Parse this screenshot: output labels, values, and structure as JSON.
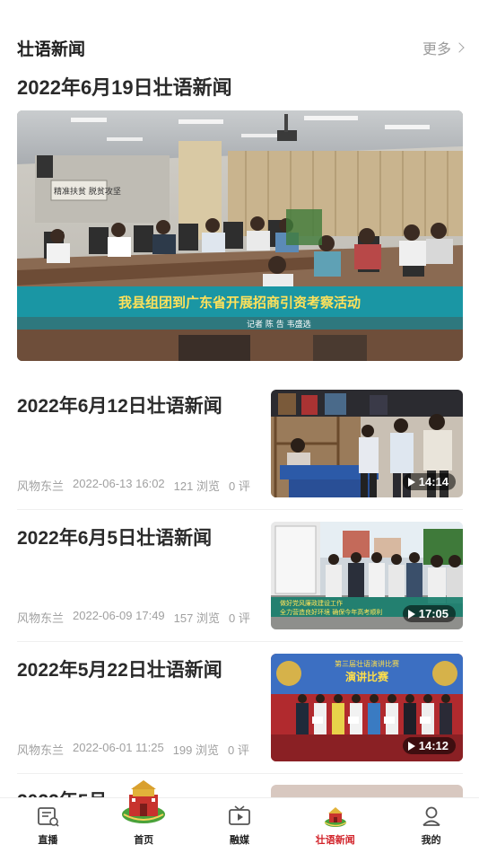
{
  "section": {
    "title": "壮语新闻",
    "more_label": "更多"
  },
  "featured": {
    "title": "2022年6月19日壮语新闻",
    "banner_text": "我县组团到广东省开展招商引资考察活动",
    "credit_text": "记者  陈 告  韦盛选",
    "wall_sign": "精准扶贫  脱贫攻坚"
  },
  "news": [
    {
      "title": "2022年6月12日壮语新闻",
      "source": "风物东兰",
      "date": "2022-06-13 16:02",
      "views": "121 浏览",
      "comments": "0 评",
      "duration": "14:14"
    },
    {
      "title": "2022年6月5日壮语新闻",
      "source": "风物东兰",
      "date": "2022-06-09 17:49",
      "views": "157 浏览",
      "comments": "0 评",
      "duration": "17:05"
    },
    {
      "title": "2022年5月22日壮语新闻",
      "source": "风物东兰",
      "date": "2022-06-01 11:25",
      "views": "199 浏览",
      "comments": "0 评",
      "duration": "14:12"
    }
  ],
  "partial_item": {
    "title": "2022年5月..."
  },
  "thumb_text": {
    "item2_caption1": "做好党风廉政建设工作",
    "item2_caption2": "全力营造良好环境 确保今年高考顺利",
    "item3_banner": "第三届壮语演讲比赛",
    "item3_sub": "演讲比赛"
  },
  "tabbar": {
    "items": [
      {
        "label": "直播",
        "icon": "live-icon"
      },
      {
        "label": "首页",
        "icon": "home-emblem-icon"
      },
      {
        "label": "融媒",
        "icon": "media-tv-icon"
      },
      {
        "label": "壮语新闻",
        "icon": "zhuang-news-icon"
      },
      {
        "label": "我的",
        "icon": "profile-icon"
      }
    ],
    "active_index": 3,
    "active_color": "#d2232a"
  }
}
